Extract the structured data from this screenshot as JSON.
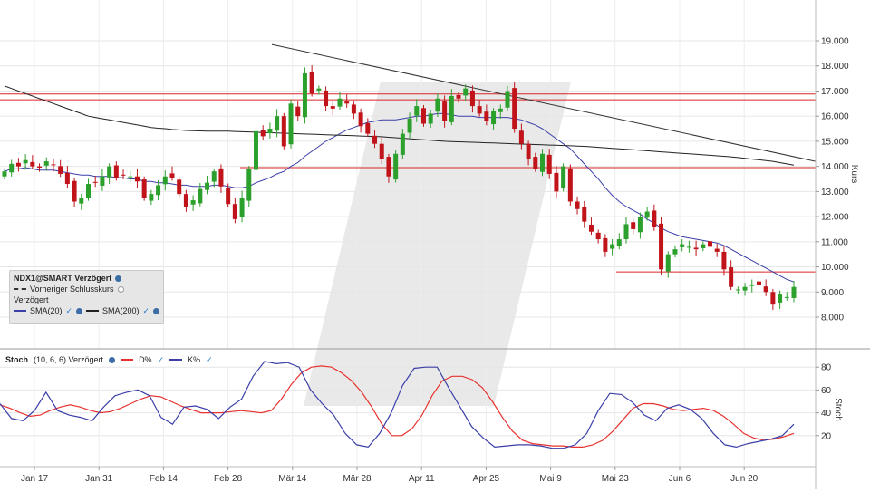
{
  "price_panel": {
    "y_axis_label": "Kurs",
    "y_ticks": [
      "19.000",
      "18.000",
      "17.000",
      "16.000",
      "15.000",
      "14.000",
      "13.000",
      "12.000",
      "11.000",
      "10.000",
      "9.000",
      "8.000"
    ]
  },
  "stoch_panel": {
    "y_axis_label": "Stoch",
    "y_ticks": [
      "80",
      "60",
      "40",
      "20"
    ]
  },
  "x_ticks": [
    "Jan 17",
    "Jan 31",
    "Feb 14",
    "Feb 28",
    "Mär 14",
    "Mär 28",
    "Apr 11",
    "Apr 25",
    "Mai 9",
    "Mai 23",
    "Jun 6",
    "Jun 20"
  ],
  "legend": {
    "symbol": "NDX1@SMART Verzögert",
    "prev_close": "Vorheriger Schlusskurs",
    "delayed": "Verzögert",
    "sma20": "SMA(20)",
    "sma200": "SMA(200)"
  },
  "stoch_header": {
    "title": "Stoch",
    "params": "(10, 6, 6) Verzögert",
    "d_label": "D%",
    "k_label": "K%"
  },
  "colors": {
    "up": "#2ca02c",
    "down": "#c0141a",
    "sma20": "#3b3fa8",
    "sma200": "#222222",
    "resistance": "#d62728",
    "trendline": "#333333",
    "d_line": "#e8322e",
    "k_line": "#3b3fa8",
    "watermark": "#e9e9e9"
  },
  "chart_data": [
    {
      "type": "candlestick",
      "title": "NDX1@SMART",
      "ylabel": "Kurs",
      "ylim": [
        7200,
        19500
      ],
      "x_tick_labels": [
        "Jan 17",
        "Jan 31",
        "Feb 14",
        "Feb 28",
        "Mär 14",
        "Mär 28",
        "Apr 11",
        "Apr 25",
        "Mai 9",
        "Mai 23",
        "Jun 6",
        "Jun 20"
      ],
      "closes": [
        13800,
        14100,
        14000,
        14250,
        14000,
        13950,
        14200,
        14050,
        13700,
        13300,
        12600,
        12750,
        13300,
        13350,
        13600,
        14000,
        13550,
        13650,
        13600,
        13400,
        12750,
        12900,
        13250,
        13600,
        13550,
        12900,
        12400,
        12650,
        13100,
        13350,
        13800,
        13200,
        12500,
        11900,
        12750,
        13900,
        15400,
        15200,
        15500,
        16000,
        14800,
        16500,
        16000,
        17700,
        16900,
        17100,
        16400,
        16300,
        16700,
        16500,
        16100,
        15600,
        15300,
        14900,
        14300,
        13600,
        14500,
        15300,
        15900,
        16400,
        15700,
        16100,
        16700,
        15800,
        16800,
        16700,
        17100,
        16400,
        16100,
        15800,
        16200,
        16300,
        17000,
        15500,
        14900,
        14300,
        13900,
        14500,
        13700,
        13000,
        14000,
        12600,
        12300,
        11800,
        11400,
        11100,
        10600,
        10900,
        11100,
        11700,
        11500,
        12000,
        12200,
        11600,
        9900,
        10500,
        10700,
        10900,
        10800,
        10700,
        10900,
        10800,
        10600,
        9900,
        9200,
        9100,
        9200,
        9300,
        9300,
        9000,
        8500,
        8900,
        8800,
        9200
      ]
    },
    {
      "type": "line",
      "series": [
        {
          "name": "SMA(20)",
          "values": [
            13800,
            13900,
            13900,
            13950,
            13900,
            13850,
            13850,
            13850,
            13800,
            13750,
            13700,
            13650,
            13650,
            13600,
            13600,
            13600,
            13550,
            13550,
            13500,
            13500,
            13400,
            13400,
            13350,
            13350,
            13300,
            13250,
            13250,
            13200,
            13200,
            13200,
            13250,
            13250,
            13200,
            13150,
            13150,
            13200,
            13350,
            13450,
            13550,
            13700,
            13800,
            14000,
            14150,
            14400,
            14600,
            14800,
            15000,
            15150,
            15300,
            15450,
            15550,
            15650,
            15750,
            15800,
            15850,
            15850,
            15850,
            15900,
            15950,
            16000,
            16000,
            16050,
            16100,
            16100,
            16050,
            16000,
            16000,
            16000,
            15950,
            15950,
            15950,
            15950,
            15950,
            15900,
            15850,
            15750,
            15650,
            15500,
            15300,
            15100,
            14900,
            14700,
            14400,
            14100,
            13800,
            13500,
            13150,
            12850,
            12600,
            12400,
            12250,
            12100,
            11900,
            11750,
            11550,
            11400,
            11300,
            11200,
            11150,
            11100,
            11050,
            11000,
            10950,
            10850,
            10700,
            10550,
            10400,
            10250,
            10100,
            9950,
            9800,
            9650,
            9500,
            9400
          ]
        },
        {
          "name": "SMA(200)",
          "values": [
            17200,
            17100,
            17000,
            16900,
            16800,
            16700,
            16600,
            16500,
            16400,
            16300,
            16200,
            16100,
            16000,
            15950,
            15900,
            15850,
            15800,
            15750,
            15700,
            15650,
            15600,
            15550,
            15520,
            15500,
            15470,
            15450,
            15430,
            15420,
            15410,
            15400,
            15400,
            15400,
            15400,
            15390,
            15380,
            15370,
            15360,
            15350,
            15340,
            15330,
            15320,
            15310,
            15300,
            15290,
            15280,
            15270,
            15260,
            15250,
            15240,
            15230,
            15220,
            15210,
            15200,
            15190,
            15180,
            15160,
            15140,
            15120,
            15100,
            15080,
            15060,
            15040,
            15020,
            15000,
            14990,
            14980,
            14970,
            14960,
            14950,
            14940,
            14930,
            14920,
            14910,
            14900,
            14890,
            14880,
            14870,
            14860,
            14850,
            14840,
            14830,
            14820,
            14810,
            14800,
            14780,
            14760,
            14740,
            14720,
            14700,
            14680,
            14660,
            14640,
            14620,
            14600,
            14580,
            14560,
            14540,
            14520,
            14500,
            14480,
            14460,
            14440,
            14420,
            14400,
            14380,
            14350,
            14320,
            14290,
            14260,
            14230,
            14200,
            14150,
            14100,
            14050
          ]
        }
      ]
    },
    {
      "type": "line",
      "title": "Stoch (10, 6, 6) Verzögert",
      "ylabel": "Stoch",
      "ylim": [
        0,
        100
      ],
      "series": [
        {
          "name": "D%",
          "values": [
            47,
            44,
            40,
            37,
            38,
            42,
            45,
            47,
            45,
            42,
            40,
            41,
            44,
            48,
            52,
            55,
            54,
            50,
            46,
            43,
            40,
            40,
            40,
            41,
            42,
            41,
            40,
            42,
            52,
            65,
            75,
            80,
            81,
            80,
            75,
            68,
            58,
            45,
            30,
            20,
            20,
            26,
            38,
            55,
            68,
            72,
            72,
            69,
            62,
            50,
            36,
            24,
            16,
            13,
            12,
            11,
            11,
            10,
            10,
            12,
            16,
            24,
            34,
            44,
            48,
            48,
            46,
            43,
            42,
            43,
            44,
            42,
            37,
            30,
            22,
            18,
            16,
            17,
            19,
            22
          ],
          "x": [
            0,
            2,
            4,
            6,
            8,
            10,
            12,
            14,
            16,
            18,
            20,
            22,
            24,
            26,
            28,
            30,
            32,
            34,
            36,
            38,
            40,
            42,
            44,
            46,
            48,
            50,
            52,
            54,
            56,
            58,
            60,
            62,
            64,
            66,
            68,
            70,
            72,
            74,
            76,
            78,
            80,
            82,
            84,
            86,
            88,
            90,
            92,
            94,
            96,
            98,
            100,
            102,
            104,
            106,
            108,
            110,
            112,
            114,
            116,
            118,
            120,
            122,
            124,
            126,
            128,
            130,
            132,
            134,
            136,
            138,
            140,
            142,
            144,
            146,
            148,
            150,
            152,
            154,
            156,
            158
          ]
        },
        {
          "name": "K%",
          "values": [
            48,
            35,
            33,
            42,
            58,
            42,
            38,
            36,
            33,
            45,
            55,
            58,
            60,
            55,
            36,
            30,
            45,
            46,
            43,
            35,
            45,
            52,
            72,
            85,
            83,
            84,
            80,
            60,
            48,
            38,
            22,
            12,
            10,
            22,
            40,
            64,
            79,
            80,
            80,
            62,
            45,
            28,
            18,
            10,
            11,
            12,
            12,
            11,
            9,
            9,
            12,
            22,
            42,
            57,
            56,
            49,
            38,
            33,
            44,
            47,
            43,
            35,
            22,
            12,
            10,
            13,
            15,
            17,
            20,
            30
          ]
        },
        {
          "name": "ref_levels",
          "values": [
            80,
            60,
            40,
            20
          ]
        }
      ]
    }
  ]
}
